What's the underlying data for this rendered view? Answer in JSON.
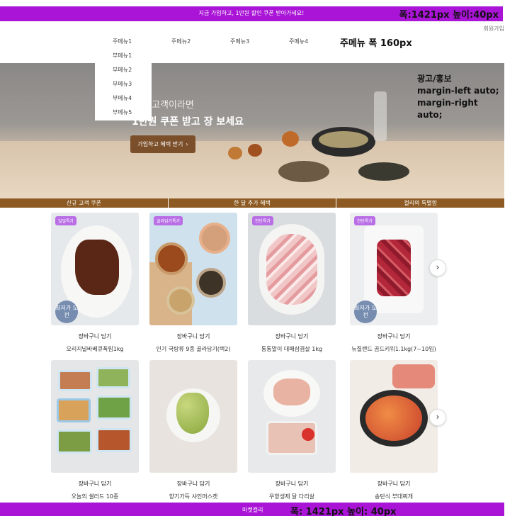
{
  "top_banner": {
    "promo": "지금 가입하고, 1만원 할인 쿠폰 받아가세요!",
    "note": "폭:1421px 높이:40px",
    "color": "#a914d6"
  },
  "header": {
    "signup": "회원가입",
    "nav": [
      "주메뉴1",
      "주메뉴2",
      "주메뉴3",
      "주메뉴4"
    ],
    "nav_note": "주메뉴 폭 160px",
    "submenu": [
      "부메뉴1",
      "부메뉴2",
      "부메뉴3",
      "부메뉴4",
      "부메뉴5"
    ]
  },
  "hero": {
    "line1": "신규 고객이라면",
    "line2": "1만원 쿠폰 받고 장 보세요",
    "cta": "가입하고 혜택 받기",
    "cta_icon": "chevron-right-icon",
    "note": [
      "광고/홍보",
      "margin-left auto;",
      "margin-right auto;"
    ],
    "cta_color": "#7b4f2a"
  },
  "tabs": [
    "신규 고객 쿠폰",
    "한 달 추가 혜택",
    "컬리의 특별함"
  ],
  "products": {
    "row1": [
      {
        "badge": "얼얼특가",
        "cart": "장바구니 담기",
        "name": "오리지널바베큐폭립1kg",
        "round": "최저가 도전"
      },
      {
        "badge": "골라담기특가",
        "cart": "장바구니 담기",
        "name": "인기 국탕류 9종 골라담기(택2)",
        "round": ""
      },
      {
        "badge": "천단특가",
        "cart": "장바구니 담기",
        "name": "통통말이 대패삼겹살 1kg",
        "round": ""
      },
      {
        "badge": "천단특가",
        "cart": "장바구니 담기",
        "name": "뉴질랜드 곰드키위1.1kg(7~10입)",
        "round": "최저가 도전"
      }
    ],
    "row2": [
      {
        "cart": "장바구니 담기",
        "name": "오늘의 샐러드 10종"
      },
      {
        "cart": "장바구니 담기",
        "name": "향기가득 샤인머스캣"
      },
      {
        "cart": "장바구니 담기",
        "name": "우항생제 닭 다리살"
      },
      {
        "cart": "장바구니 담기",
        "name": "송탄식 부대찌개"
      }
    ],
    "next_icon": "chevron-right-icon"
  },
  "footer": {
    "label": "마켓컬리",
    "note": "폭: 1421px 높이: 40px",
    "color": "#a914d6"
  }
}
